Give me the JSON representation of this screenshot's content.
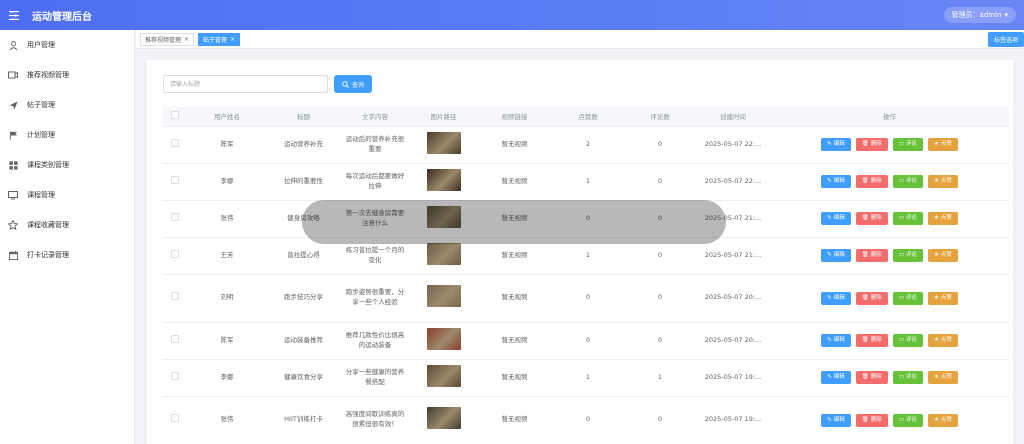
{
  "header": {
    "title": "运动管理后台",
    "user_label": "管理员：admin"
  },
  "sidebar": {
    "items": [
      {
        "label": "用户管理",
        "icon": "user-icon"
      },
      {
        "label": "推荐视频管理",
        "icon": "video-icon"
      },
      {
        "label": "帖子管理",
        "icon": "send-icon"
      },
      {
        "label": "计划管理",
        "icon": "flag-icon"
      },
      {
        "label": "课程类别管理",
        "icon": "grid-icon"
      },
      {
        "label": "课程管理",
        "icon": "monitor-icon"
      },
      {
        "label": "课程收藏管理",
        "icon": "star-icon"
      },
      {
        "label": "打卡记录管理",
        "icon": "calendar-icon"
      }
    ]
  },
  "tabs": [
    {
      "label": "推荐视频管理",
      "active": false
    },
    {
      "label": "帖子管理",
      "active": true
    }
  ],
  "tab_more": "标签选项",
  "search": {
    "placeholder": "请输入标题",
    "button": "查询"
  },
  "table": {
    "headers": [
      "用户姓名",
      "标题",
      "文字内容",
      "图片路径",
      "视频链接",
      "点赞数",
      "评论数",
      "创建时间",
      "操作"
    ],
    "actions": {
      "edit": "编辑",
      "delete": "删除",
      "comment": "评论",
      "like": "点赞"
    },
    "rows": [
      {
        "user": "陈军",
        "title": "运动营养补充",
        "content": "运动后的营养补充很重要",
        "video": "暂无视频",
        "likes": "2",
        "comments": "0",
        "created": "2025-05-07 22:...",
        "thumb": "#4a3a2c"
      },
      {
        "user": "李娜",
        "title": "拉伸的重要性",
        "content": "每次运动后都要做好拉伸",
        "video": "暂无视频",
        "likes": "1",
        "comments": "0",
        "created": "2025-05-07 22:...",
        "thumb": "#3c2a22"
      },
      {
        "user": "张伟",
        "title": "健身房攻略",
        "content": "第一次去健身房需要注意什么",
        "video": "暂无视频",
        "likes": "0",
        "comments": "0",
        "created": "2025-05-07 21:...",
        "thumb": "#53503a"
      },
      {
        "user": "王芳",
        "title": "普拉提心得",
        "content": "练习普拉提一个月的变化",
        "video": "暂无视频",
        "likes": "1",
        "comments": "0",
        "created": "2025-05-07 21:...",
        "thumb": "#6b5a48"
      },
      {
        "user": "刘明",
        "title": "跑步技巧分享",
        "content": "跑步姿势很重要，分享一些个人经验",
        "video": "暂无视频",
        "likes": "0",
        "comments": "0",
        "created": "2025-05-07 20:...",
        "thumb": "#7a6650"
      },
      {
        "user": "陈军",
        "title": "运动装备推荐",
        "content": "推荐几款性价比很高的运动装备",
        "video": "暂无视频",
        "likes": "0",
        "comments": "0",
        "created": "2025-05-07 20:...",
        "thumb": "#8a3e2e"
      },
      {
        "user": "李娜",
        "title": "健康饮食分享",
        "content": "分享一些健康的营养餐搭配",
        "video": "暂无视频",
        "likes": "1",
        "comments": "1",
        "created": "2025-05-07 19:...",
        "thumb": "#5d4632"
      },
      {
        "user": "张伟",
        "title": "HIIT训练打卡",
        "content": "高强度间歇训练真的很累但很有效！",
        "video": "暂无视频",
        "likes": "0",
        "comments": "0",
        "created": "2025-05-07 19:...",
        "thumb": "#3f3a30"
      }
    ]
  }
}
